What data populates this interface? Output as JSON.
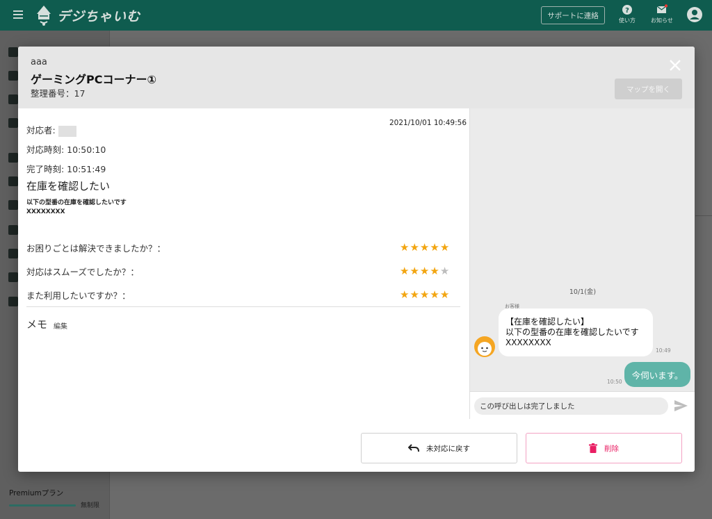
{
  "app": {
    "logo_text": "デジちゃいむ",
    "support_label": "サポートに連絡",
    "help_label": "使い方",
    "notice_label": "お知らせ",
    "theme_color": "#0f5c4f"
  },
  "sidebar": {
    "plan_name": "Premiumプラン",
    "plan_limit": "無制限"
  },
  "modal": {
    "subtitle": "aaa",
    "title": "ゲーミングPCコーナー①",
    "id_line": "整理番号：17",
    "map_button": "マップを開く",
    "timestamp": "2021/10/01 10:49:56",
    "responder_label": "対応者:",
    "response_time": "対応時刻: 10:50:10",
    "complete_time": "完了時刻: 10:51:49",
    "inquiry_title": "在庫を確認したい",
    "inquiry_line1": "以下の型番の在庫を確認したいです",
    "inquiry_line2": "XXXXXXXX",
    "survey": [
      {
        "question": "お困りごとは解決できましたか？：",
        "rating": 5,
        "max": 5
      },
      {
        "question": "対応はスムーズでしたか？：",
        "rating": 4,
        "max": 5
      },
      {
        "question": "また利用したいですか？：",
        "rating": 5,
        "max": 5
      }
    ],
    "memo_label": "メモ",
    "memo_edit": "編集",
    "back_button": "未対応に戻す",
    "delete_button": "削除"
  },
  "chat": {
    "date": "10/1(金)",
    "sender_label": "お客様",
    "incoming_line1": "【在庫を確認したい】",
    "incoming_line2": "以下の型番の在庫を確認したいです",
    "incoming_line3": "XXXXXXXX",
    "incoming_time": "10:49",
    "outgoing_text": "今伺います。",
    "outgoing_time": "10:50",
    "input_value": "この呼び出しは完了しました"
  },
  "colors": {
    "star_on": "#f2a511",
    "star_off": "#bdbdbd",
    "outgoing_bubble": "#5fb4a8",
    "delete": "#e91e63"
  }
}
